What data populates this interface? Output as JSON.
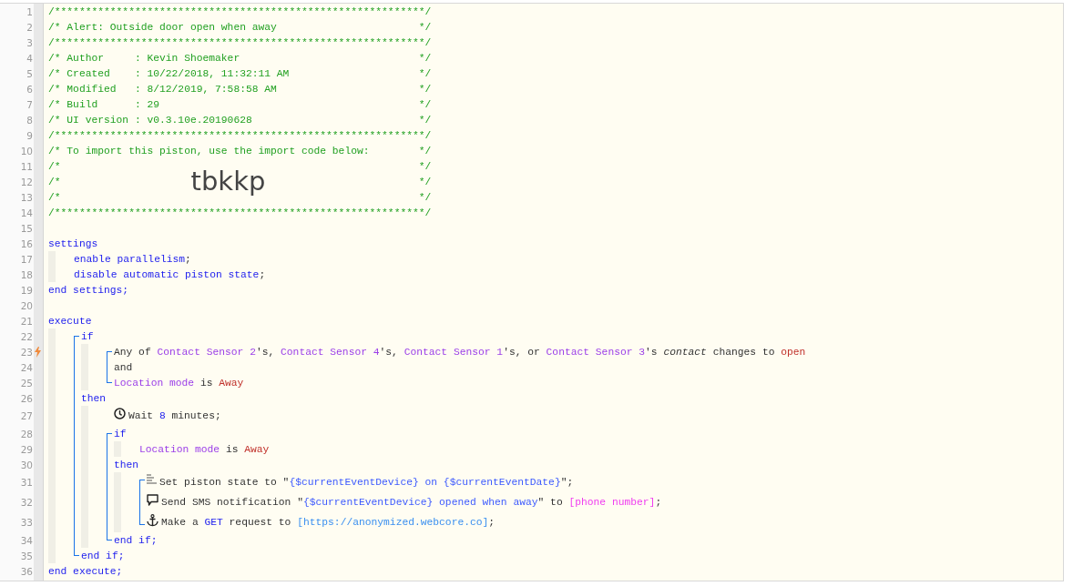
{
  "editor": {
    "nodes": [
      {
        "kind": "rule",
        "number": "1",
        "trigger": false,
        "tokens": [
          {
            "kind": "comment",
            "text": "/************************************************************/"
          }
        ]
      },
      {
        "kind": "box",
        "number": "2",
        "trigger": false,
        "tokens": [
          {
            "kind": "comment",
            "text": "/* Alert: Outside door open when away"
          },
          {
            "kind": "comment",
            "text": "*/"
          }
        ]
      },
      {
        "kind": "rule",
        "number": "3",
        "trigger": false,
        "tokens": [
          {
            "kind": "comment",
            "text": "/************************************************************/"
          }
        ]
      },
      {
        "kind": "box",
        "number": "4",
        "trigger": false,
        "tokens": [
          {
            "kind": "comment",
            "text": "/* Author     : Kevin Shoemaker"
          },
          {
            "kind": "comment",
            "text": "*/"
          }
        ]
      },
      {
        "kind": "box",
        "number": "5",
        "trigger": false,
        "tokens": [
          {
            "kind": "comment",
            "text": "/* Created    : 10/22/2018, 11:32:11 AM"
          },
          {
            "kind": "comment",
            "text": "*/"
          }
        ]
      },
      {
        "kind": "box",
        "number": "6",
        "trigger": false,
        "tokens": [
          {
            "kind": "comment",
            "text": "/* Modified   : 8/12/2019, 7:58:58 AM"
          },
          {
            "kind": "comment",
            "text": "*/"
          }
        ]
      },
      {
        "kind": "box",
        "number": "7",
        "trigger": false,
        "tokens": [
          {
            "kind": "comment",
            "text": "/* Build      : 29"
          },
          {
            "kind": "comment",
            "text": "*/"
          }
        ]
      },
      {
        "kind": "box",
        "number": "8",
        "trigger": false,
        "tokens": [
          {
            "kind": "comment",
            "text": "/* UI version : v0.3.10e.20190628"
          },
          {
            "kind": "comment",
            "text": "*/"
          }
        ]
      },
      {
        "kind": "rule",
        "number": "9",
        "trigger": false,
        "tokens": [
          {
            "kind": "comment",
            "text": "/************************************************************/"
          }
        ]
      },
      {
        "kind": "box",
        "number": "10",
        "trigger": false,
        "tokens": [
          {
            "kind": "comment",
            "text": "/* To import this piston, use the import code below:"
          },
          {
            "kind": "comment",
            "text": "*/"
          }
        ]
      },
      {
        "kind": "box",
        "number": "11",
        "trigger": false,
        "tokens": [
          {
            "kind": "comment",
            "text": "/*"
          },
          {
            "kind": "comment",
            "text": "*/"
          }
        ]
      },
      {
        "kind": "box",
        "number": "12",
        "trigger": false,
        "tokens": [
          {
            "kind": "comment",
            "text": "/*"
          },
          {
            "kind": "code",
            "text": "tbkkp"
          },
          {
            "kind": "comment",
            "text": "*/"
          }
        ]
      },
      {
        "kind": "box",
        "number": "13",
        "trigger": false,
        "tokens": [
          {
            "kind": "comment",
            "text": "/*"
          },
          {
            "kind": "comment",
            "text": "*/"
          }
        ]
      },
      {
        "kind": "rule",
        "number": "14",
        "trigger": false,
        "tokens": [
          {
            "kind": "comment",
            "text": "/************************************************************/"
          }
        ]
      },
      {
        "kind": "line",
        "number": "15",
        "trigger": false
      },
      {
        "kind": "line",
        "number": "16",
        "trigger": false,
        "tokens": [
          {
            "kind": "keyword",
            "text": "settings"
          }
        ]
      },
      {
        "kind": "block",
        "children": [
          {
            "kind": "line",
            "number": "17",
            "trigger": false,
            "tokens": [
              {
                "kind": "keyword",
                "text": "enable parallelism"
              },
              {
                "kind": "plain",
                "text": ";"
              }
            ]
          },
          {
            "kind": "line",
            "number": "18",
            "trigger": false,
            "tokens": [
              {
                "kind": "keyword",
                "text": "disable automatic piston state"
              },
              {
                "kind": "plain",
                "text": ";"
              }
            ]
          }
        ]
      },
      {
        "kind": "line",
        "number": "19",
        "trigger": false,
        "tokens": [
          {
            "kind": "keyword",
            "text": "end settings;"
          }
        ]
      },
      {
        "kind": "line",
        "number": "20",
        "trigger": false
      },
      {
        "kind": "line",
        "number": "21",
        "trigger": false,
        "tokens": [
          {
            "kind": "keyword",
            "text": "execute"
          }
        ]
      },
      {
        "kind": "block",
        "children": [
          {
            "kind": "group",
            "bracket": true,
            "children": [
              {
                "kind": "line",
                "number": "22",
                "trigger": false,
                "tokens": [
                  {
                    "kind": "keyword",
                    "text": "if"
                  }
                ]
              },
              {
                "kind": "block",
                "children": [
                  {
                    "kind": "group",
                    "bracket": true,
                    "children": [
                      {
                        "kind": "line",
                        "number": "23",
                        "trigger": true,
                        "tokens": [
                          {
                            "kind": "plain",
                            "text": "Any of "
                          },
                          {
                            "kind": "device",
                            "text": "Contact Sensor 2"
                          },
                          {
                            "kind": "plain",
                            "text": "'s, "
                          },
                          {
                            "kind": "device",
                            "text": "Contact Sensor 4"
                          },
                          {
                            "kind": "plain",
                            "text": "'s, "
                          },
                          {
                            "kind": "device",
                            "text": "Contact Sensor 1"
                          },
                          {
                            "kind": "plain",
                            "text": "'s, or "
                          },
                          {
                            "kind": "device",
                            "text": "Contact Sensor 3"
                          },
                          {
                            "kind": "plain",
                            "text": "'s "
                          },
                          {
                            "kind": "attribute",
                            "text": "contact"
                          },
                          {
                            "kind": "plain",
                            "text": " changes to "
                          },
                          {
                            "kind": "value",
                            "text": "open"
                          }
                        ]
                      },
                      {
                        "kind": "line",
                        "number": "24",
                        "trigger": false,
                        "tokens": [
                          {
                            "kind": "plain",
                            "text": "and"
                          }
                        ]
                      },
                      {
                        "kind": "line",
                        "number": "25",
                        "trigger": false,
                        "tokens": [
                          {
                            "kind": "device",
                            "text": "Location mode"
                          },
                          {
                            "kind": "plain",
                            "text": " is "
                          },
                          {
                            "kind": "value",
                            "text": "Away"
                          }
                        ]
                      }
                    ]
                  }
                ]
              },
              {
                "kind": "line",
                "number": "26",
                "trigger": false,
                "tokens": [
                  {
                    "kind": "keyword",
                    "text": "then"
                  }
                ]
              },
              {
                "kind": "block",
                "children": [
                  {
                    "kind": "group",
                    "bracket": false,
                    "children": [
                      {
                        "kind": "wait",
                        "number": "27",
                        "trigger": false,
                        "tokens": [
                          {
                            "kind": "plain",
                            "text": "Wait "
                          },
                          {
                            "kind": "keyword",
                            "text": "8"
                          },
                          {
                            "kind": "plain",
                            "text": " minutes;"
                          }
                        ]
                      }
                    ]
                  },
                  {
                    "kind": "group",
                    "bracket": true,
                    "children": [
                      {
                        "kind": "line",
                        "number": "28",
                        "trigger": false,
                        "tokens": [
                          {
                            "kind": "keyword",
                            "text": "if"
                          }
                        ]
                      },
                      {
                        "kind": "block",
                        "children": [
                          {
                            "kind": "line",
                            "number": "29",
                            "trigger": false,
                            "tokens": [
                              {
                                "kind": "device",
                                "text": "Location mode"
                              },
                              {
                                "kind": "plain",
                                "text": " is "
                              },
                              {
                                "kind": "value",
                                "text": "Away"
                              }
                            ]
                          }
                        ]
                      },
                      {
                        "kind": "line",
                        "number": "30",
                        "trigger": false,
                        "tokens": [
                          {
                            "kind": "keyword",
                            "text": "then"
                          }
                        ]
                      },
                      {
                        "kind": "block",
                        "children": [
                          {
                            "kind": "group",
                            "bracket": true,
                            "children": [
                              {
                                "kind": "set_state",
                                "number": "31",
                                "trigger": false,
                                "tokens": [
                                  {
                                    "kind": "plain",
                                    "text": "Set piston state to \""
                                  },
                                  {
                                    "kind": "string",
                                    "text": "{$currentEventDevice} on {$currentEventDate}"
                                  },
                                  {
                                    "kind": "plain",
                                    "text": "\";"
                                  }
                                ]
                              },
                              {
                                "kind": "notify",
                                "number": "32",
                                "trigger": false,
                                "tokens": [
                                  {
                                    "kind": "plain",
                                    "text": "Send SMS notification \""
                                  },
                                  {
                                    "kind": "string",
                                    "text": "{$currentEventDevice} opened when away"
                                  },
                                  {
                                    "kind": "plain",
                                    "text": "\" to "
                                  },
                                  {
                                    "kind": "phone",
                                    "text": "[phone number]"
                                  },
                                  {
                                    "kind": "plain",
                                    "text": ";"
                                  }
                                ]
                              },
                              {
                                "kind": "request",
                                "number": "33",
                                "trigger": false,
                                "tokens": [
                                  {
                                    "kind": "plain",
                                    "text": "Make a "
                                  },
                                  {
                                    "kind": "keyword",
                                    "text": "GET"
                                  },
                                  {
                                    "kind": "plain",
                                    "text": " request to "
                                  },
                                  {
                                    "kind": "url",
                                    "text": "[https://anonymized.webcore.co]"
                                  },
                                  {
                                    "kind": "plain",
                                    "text": ";"
                                  }
                                ]
                              }
                            ]
                          }
                        ]
                      },
                      {
                        "kind": "line",
                        "number": "34",
                        "trigger": false,
                        "tokens": [
                          {
                            "kind": "keyword",
                            "text": "end if;"
                          }
                        ]
                      }
                    ]
                  }
                ]
              },
              {
                "kind": "line",
                "number": "35",
                "trigger": false,
                "tokens": [
                  {
                    "kind": "keyword",
                    "text": "end if;"
                  }
                ]
              }
            ]
          }
        ]
      },
      {
        "kind": "line",
        "number": "36",
        "trigger": false,
        "tokens": [
          {
            "kind": "keyword",
            "text": "end execute;"
          }
        ]
      }
    ]
  }
}
